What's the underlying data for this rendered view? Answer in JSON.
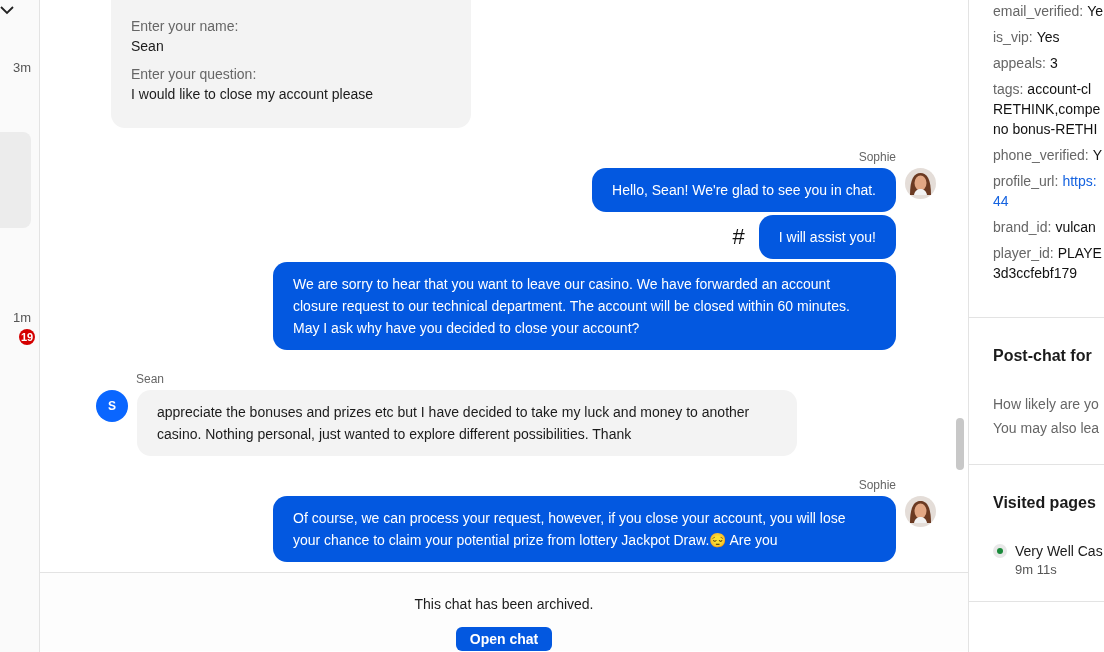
{
  "conversations": [
    {
      "time": "3m",
      "selected": false
    },
    {
      "selected": true
    },
    {
      "time": "1m",
      "unread": "19",
      "selected": false
    }
  ],
  "messages": [
    {
      "kind": "form",
      "fields": [
        {
          "label": "Enter your name:",
          "value": "Sean"
        },
        {
          "label": "Enter your question:",
          "value": "I would like to close my account please"
        }
      ]
    },
    {
      "kind": "agent",
      "sender": "Sophie",
      "bubbles": [
        {
          "text": "Hello, Sean! We're glad to see you in chat."
        },
        {
          "text": "I will assist you!",
          "marker": "#"
        },
        {
          "text": "We are sorry to hear that you want to leave our casino. We have forwarded an account closure request to our technical department. The account will be closed within 60 minutes. May I ask why have you decided to close your account?"
        }
      ]
    },
    {
      "kind": "customer",
      "sender": "Sean",
      "initial": "S",
      "bubbles": [
        {
          "text": "appreciate the bonuses and prizes etc but I have decided to take my luck and money to another casino. Nothing personal, just wanted to explore different possibilities. Thank"
        }
      ]
    },
    {
      "kind": "agent",
      "sender": "Sophie",
      "bubbles": [
        {
          "text": "Of course, we can process your request, however, if you close your account, you will lose your chance to claim your potential prize from lottery Jackpot Draw.😔 Are you"
        }
      ]
    }
  ],
  "footer": {
    "notice": "This chat has been archived.",
    "button": "Open chat"
  },
  "details": [
    {
      "kind": "text",
      "key": "email_verified:",
      "value": [
        "Ye"
      ]
    },
    {
      "kind": "text",
      "key": "is_vip:",
      "value": [
        "Yes"
      ]
    },
    {
      "kind": "text",
      "key": "appeals:",
      "value": [
        "3"
      ]
    },
    {
      "kind": "text",
      "key": "tags:",
      "value": [
        "account-cl",
        "RETHINK,compe",
        "no bonus-RETHI"
      ]
    },
    {
      "kind": "text",
      "key": "phone_verified:",
      "value": [
        "Y"
      ]
    },
    {
      "kind": "link",
      "key": "profile_url:",
      "value": [
        "https:",
        "44"
      ]
    },
    {
      "kind": "text",
      "key": "brand_id:",
      "value": [
        "vulcan"
      ]
    },
    {
      "kind": "text",
      "key": "player_id:",
      "value": [
        "PLAYE",
        "3d3ccfebf179"
      ]
    }
  ],
  "post_chat_form": {
    "title": "Post-chat for",
    "lines": [
      "How likely are yo",
      "You may also lea"
    ]
  },
  "visited_pages": {
    "title": "Visited pages",
    "items": [
      {
        "title": "Very Well Cas",
        "duration": "9m 11s",
        "color": "#1a8a3a"
      }
    ]
  }
}
